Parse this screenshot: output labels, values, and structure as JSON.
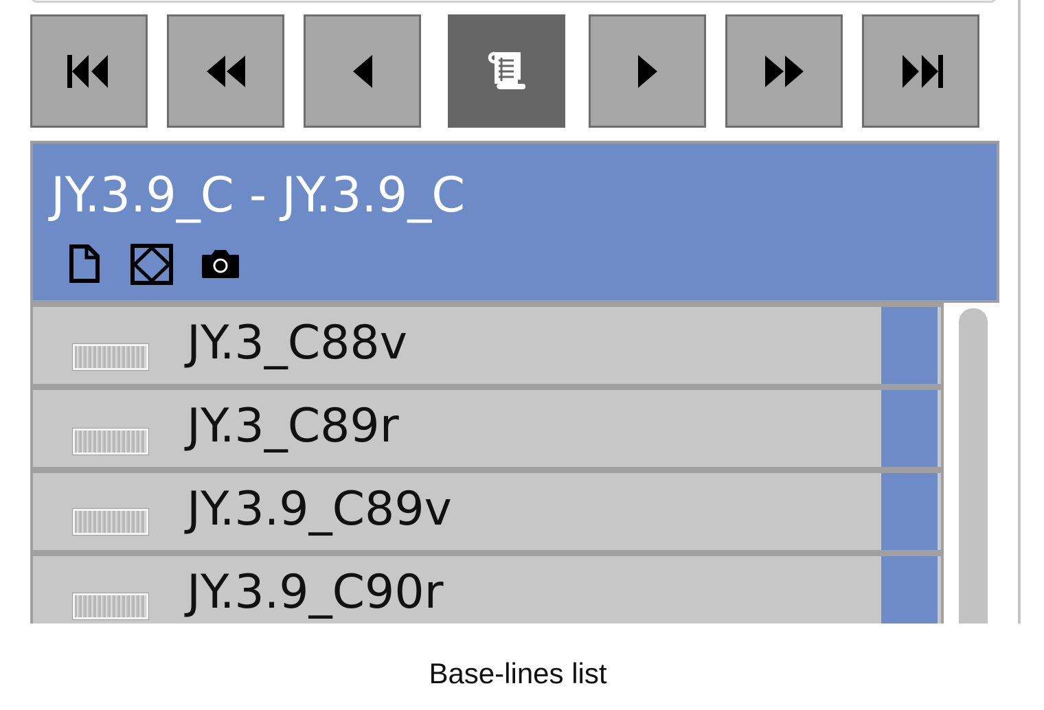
{
  "navigation": {
    "buttons": [
      {
        "name": "first",
        "icon": "skip-to-first-icon",
        "active": false
      },
      {
        "name": "previous-page",
        "icon": "fast-backward-icon",
        "active": false
      },
      {
        "name": "previous",
        "icon": "step-backward-icon",
        "active": false
      },
      {
        "name": "transcription",
        "icon": "scroll-icon",
        "active": true
      },
      {
        "name": "next",
        "icon": "step-forward-icon",
        "active": false
      },
      {
        "name": "next-page",
        "icon": "fast-forward-icon",
        "active": false
      },
      {
        "name": "last",
        "icon": "skip-to-last-icon",
        "active": false
      }
    ]
  },
  "header": {
    "title": "JY.3.9_C - JY.3.9_C",
    "icons": [
      "document-icon",
      "region-icon",
      "camera-icon"
    ]
  },
  "list": {
    "items": [
      {
        "label": "JY.3_C88v",
        "thumbnail": "line-image-thumbnail"
      },
      {
        "label": "JY.3_C89r",
        "thumbnail": "line-image-thumbnail"
      },
      {
        "label": "JY.3.9_C89v",
        "thumbnail": "line-image-thumbnail"
      },
      {
        "label": "JY.3.9_C90r",
        "thumbnail": "line-image-thumbnail"
      }
    ]
  },
  "caption": "Base-lines list",
  "colors": {
    "accent": "#6d8bc7",
    "button": "#a6a6a6",
    "button_active": "#666666",
    "row": "#c7c7c7"
  }
}
